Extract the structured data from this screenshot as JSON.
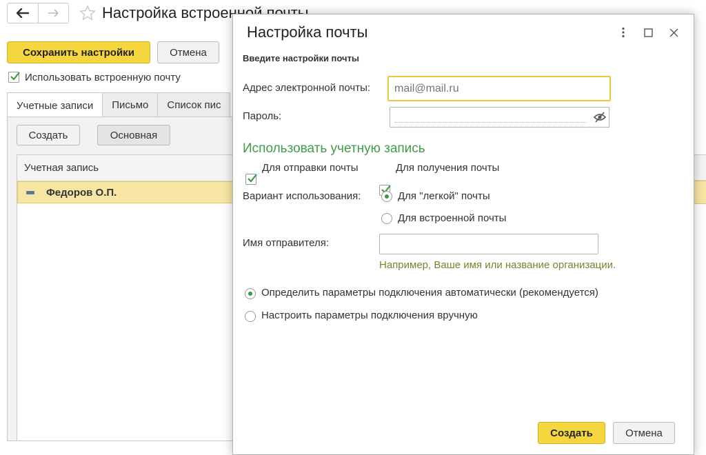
{
  "main_window": {
    "title": "Настройка встроенной почты",
    "save_button": "Сохранить настройки",
    "cancel_button": "Отмена",
    "use_builtin_mail_label": "Использовать встроенную почту",
    "use_builtin_mail_checked": true,
    "tabs": [
      {
        "label": "Учетные записи",
        "active": true
      },
      {
        "label": "Письмо",
        "active": false
      },
      {
        "label": "Список пис",
        "active": false
      }
    ],
    "create_button": "Создать",
    "main_button": "Основная",
    "accounts_table": {
      "column_header": "Учетная запись",
      "rows": [
        {
          "name": "Федоров О.П."
        }
      ]
    }
  },
  "dialog": {
    "title": "Настройка почты",
    "subtitle": "Введите настройки почты",
    "email_label": "Адрес электронной почты:",
    "email_placeholder": "mail@mail.ru",
    "email_value": "",
    "password_label": "Пароль:",
    "section_title": "Использовать учетную запись",
    "send_mail_label": "Для отправки почты",
    "send_mail_checked": true,
    "receive_mail_label": "Для получения почты",
    "receive_mail_checked": true,
    "usage_label": "Вариант использования:",
    "usage_options": [
      {
        "label": "Для \"легкой\" почты",
        "selected": true
      },
      {
        "label": "Для встроенной почты",
        "selected": false
      }
    ],
    "sender_name_label": "Имя отправителя:",
    "sender_name_value": "",
    "sender_hint": "Например, Ваше имя или название организации.",
    "connection_options": [
      {
        "label": "Определить параметры подключения автоматически (рекомендуется)",
        "selected": true
      },
      {
        "label": "Настроить параметры подключения вручную",
        "selected": false
      }
    ],
    "create_button": "Создать",
    "cancel_button": "Отмена"
  },
  "colors": {
    "accent_yellow": "#f5d63e",
    "section_green": "#3f9c4a",
    "hint_green": "#6d8a2e",
    "selected_row": "#f7e5a3"
  }
}
